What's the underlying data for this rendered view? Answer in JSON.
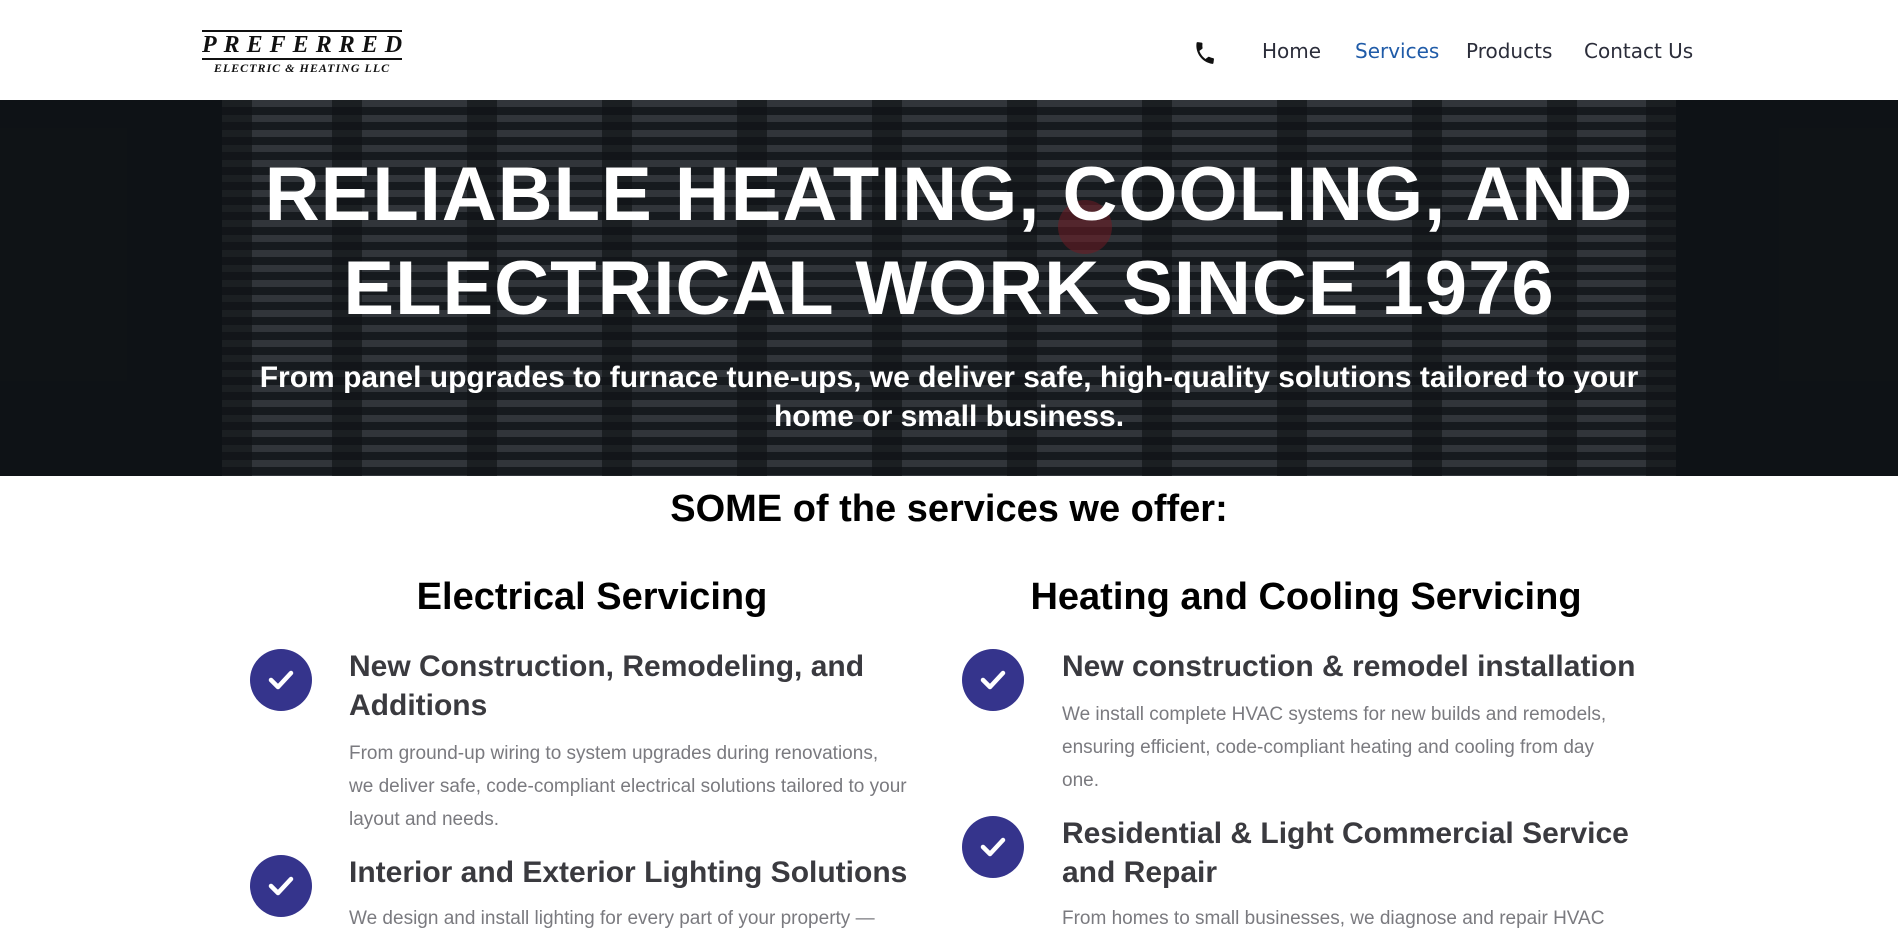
{
  "header": {
    "logo_brand": "PREFERRED",
    "logo_sub": "ELECTRIC & HEATING LLC",
    "nav": [
      "Home",
      "Services",
      "Products",
      "Contact Us"
    ],
    "active_nav": "Services",
    "accent_color": "#1f5ba8"
  },
  "hero": {
    "title_line1": "RELIABLE HEATING, COOLING, AND",
    "title_line2": "ELECTRICAL WORK SINCE 1976",
    "subtitle_line1": "From panel upgrades to furnace tune-ups, we deliver safe, high-quality solutions tailored to your",
    "subtitle_line2": "home or small business."
  },
  "services": {
    "section_title": "SOME of the services we offer:",
    "check_color": "#35348c",
    "electrical": {
      "title": "Electrical Servicing",
      "items": [
        {
          "title_line1": "New Construction, Remodeling, and",
          "title_line2": "Additions",
          "desc_line1": "From ground-up wiring to system upgrades during renovations,",
          "desc_line2": "we deliver safe, code-compliant electrical solutions tailored to your",
          "desc_line3": "layout and needs."
        },
        {
          "title_line1": "Interior and Exterior Lighting Solutions",
          "desc_line1": "We design and install lighting for every part of your property —"
        }
      ]
    },
    "hvac": {
      "title": "Heating and Cooling Servicing",
      "items": [
        {
          "title_line1": "New construction & remodel installation",
          "desc_line1": "We install complete HVAC systems for new builds and remodels,",
          "desc_line2": "ensuring efficient, code-compliant heating and cooling from day",
          "desc_line3": "one."
        },
        {
          "title_line1": "Residential & Light Commercial Service",
          "title_line2": "and Repair",
          "desc_line1": "From homes to small businesses, we diagnose and repair HVAC"
        }
      ]
    }
  }
}
